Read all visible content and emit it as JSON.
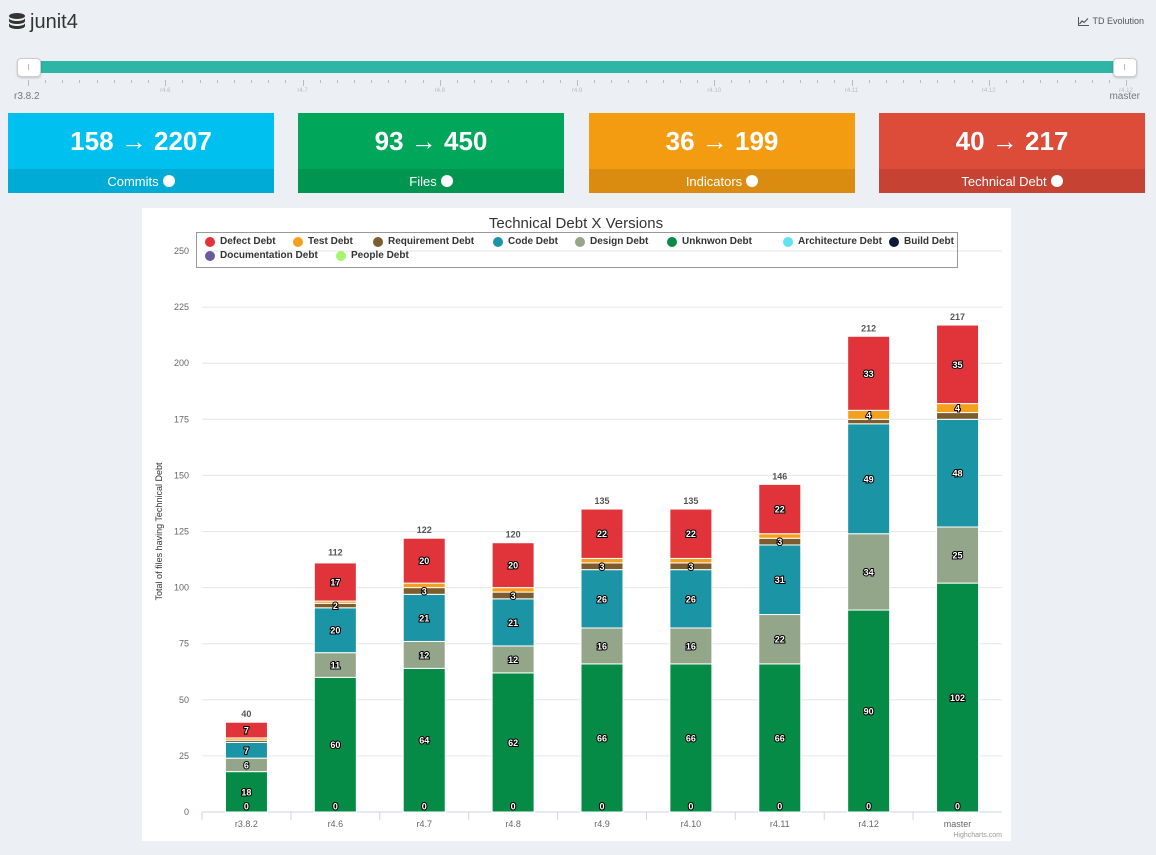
{
  "header": {
    "title": "junit4",
    "td_link": "TD Evolution"
  },
  "slider": {
    "start_label": "r3.8.2",
    "end_label": "master",
    "tick_labels": [
      "r4.6",
      "r4.7",
      "r4.8",
      "r4.9",
      "r4.10",
      "r4.11",
      "r4.12",
      "r4.12"
    ]
  },
  "cards": [
    {
      "value": "158 → 2207",
      "label": "Commits",
      "color": "#00c0ef"
    },
    {
      "value": "93 → 450",
      "label": "Files",
      "color": "#00a65a"
    },
    {
      "value": "36 → 199",
      "label": "Indicators",
      "color": "#f39c12"
    },
    {
      "value": "40 → 217",
      "label": "Technical Debt",
      "color": "#dd4b39"
    }
  ],
  "chart_data": {
    "type": "bar",
    "stacked": true,
    "title": "Technical Debt X Versions",
    "xlabel": "",
    "ylabel": "Total of files having Technical Debt",
    "ylim": [
      0,
      250
    ],
    "yticks": [
      0,
      25,
      50,
      75,
      100,
      125,
      150,
      175,
      200,
      225,
      250
    ],
    "categories": [
      "r3.8.2",
      "r4.6",
      "r4.7",
      "r4.8",
      "r4.9",
      "r4.10",
      "r4.11",
      "r4.12",
      "master"
    ],
    "totals": [
      40,
      112,
      122,
      120,
      135,
      135,
      146,
      212,
      217
    ],
    "series": [
      {
        "name": "Defect Debt",
        "color": "#e0333a",
        "values": [
          7,
          17,
          20,
          20,
          22,
          22,
          22,
          33,
          35
        ]
      },
      {
        "name": "Test Debt",
        "color": "#f2a01e",
        "values": [
          1,
          1,
          2,
          2,
          2,
          2,
          2,
          4,
          4
        ]
      },
      {
        "name": "Requirement Debt",
        "color": "#7d5c2e",
        "values": [
          1,
          2,
          3,
          3,
          3,
          3,
          3,
          2,
          3
        ]
      },
      {
        "name": "Code Debt",
        "color": "#1b94a6",
        "values": [
          7,
          20,
          21,
          21,
          26,
          26,
          31,
          49,
          48
        ]
      },
      {
        "name": "Design Debt",
        "color": "#93a68a",
        "values": [
          6,
          11,
          12,
          12,
          16,
          16,
          22,
          34,
          25
        ]
      },
      {
        "name": "Unknwon Debt",
        "color": "#058b46",
        "values": [
          18,
          60,
          64,
          62,
          66,
          66,
          66,
          90,
          102
        ]
      },
      {
        "name": "Architecture Debt",
        "color": "#5ee3f2",
        "values": [
          0,
          0,
          0,
          0,
          0,
          0,
          0,
          0,
          0
        ]
      },
      {
        "name": "Build Debt",
        "color": "#0c1a3a",
        "values": [
          0,
          0,
          0,
          0,
          0,
          0,
          0,
          0,
          0
        ]
      },
      {
        "name": "Documentation Debt",
        "color": "#6a5b9e",
        "values": [
          0,
          0,
          0,
          0,
          0,
          0,
          0,
          0,
          0
        ]
      },
      {
        "name": "People Debt",
        "color": "#a7f46f",
        "values": [
          0,
          0,
          0,
          0,
          0,
          0,
          0,
          0,
          0
        ]
      }
    ],
    "data_labels": [
      {
        "series": "Defect Debt",
        "labels": [
          "7",
          "17",
          "20",
          "20",
          "22",
          "22",
          "22",
          "33",
          "35"
        ]
      },
      {
        "series": "Test Debt",
        "labels": [
          "",
          "",
          "",
          "",
          "",
          "",
          "",
          "4",
          "4"
        ]
      },
      {
        "series": "Requirement Debt",
        "labels": [
          "",
          "2",
          "3",
          "3",
          "3",
          "3",
          "3",
          "",
          ""
        ]
      },
      {
        "series": "Code Debt",
        "labels": [
          "7",
          "20",
          "21",
          "21",
          "26",
          "26",
          "31",
          "49",
          "48"
        ]
      },
      {
        "series": "Design Debt",
        "labels": [
          "6",
          "11",
          "12",
          "12",
          "16",
          "16",
          "22",
          "34",
          "25"
        ]
      },
      {
        "series": "Unknwon Debt",
        "labels": [
          "18",
          "60",
          "64",
          "62",
          "66",
          "66",
          "66",
          "90",
          "102"
        ]
      },
      {
        "series": "People Debt",
        "labels": [
          "0",
          "0",
          "0",
          "0",
          "0",
          "0",
          "0",
          "0",
          "0"
        ]
      }
    ],
    "legend_position": "top",
    "credit": "Highcharts.com"
  }
}
